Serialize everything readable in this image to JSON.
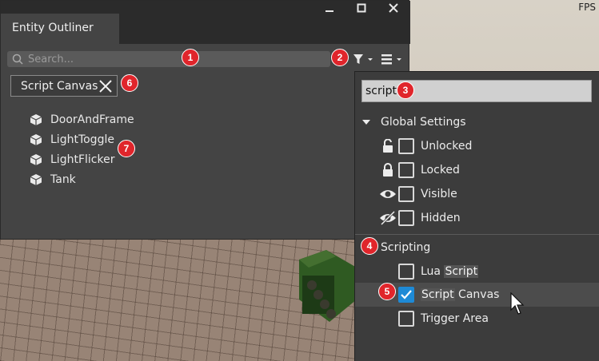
{
  "viewport": {
    "fps_label": "FPS"
  },
  "window": {
    "tab_title": "Entity Outliner"
  },
  "search": {
    "placeholder": "Search..."
  },
  "active_filter": {
    "label": "Script Canvas"
  },
  "entities": [
    {
      "name": "DoorAndFrame",
      "icon": "entity-cube-icon"
    },
    {
      "name": "LightToggle",
      "icon": "entity-cube-icon"
    },
    {
      "name": "LightFlicker",
      "icon": "entity-cube-icon"
    },
    {
      "name": "Tank",
      "icon": "entity-cube-icon"
    }
  ],
  "filter_menu": {
    "search_value": "script",
    "global_settings": {
      "label": "Global Settings",
      "options": [
        {
          "label": "Unlocked",
          "icon": "unlock-icon",
          "checked": false
        },
        {
          "label": "Locked",
          "icon": "lock-icon",
          "checked": false
        },
        {
          "label": "Visible",
          "icon": "eye-icon",
          "checked": false
        },
        {
          "label": "Hidden",
          "icon": "eye-slash-icon",
          "checked": false
        }
      ]
    },
    "scripting": {
      "label": "Scripting",
      "options": [
        {
          "pre": "Lua ",
          "match": "Script",
          "post": "",
          "checked": false
        },
        {
          "pre": "",
          "match": "Script",
          "post": " Canvas",
          "checked": true
        },
        {
          "pre": "Trigger Area",
          "match": "",
          "post": "",
          "checked": false
        }
      ]
    }
  },
  "badges": [
    "1",
    "2",
    "3",
    "4",
    "5",
    "6",
    "7"
  ],
  "colors": {
    "badge": "#e0252b",
    "checkbox_checked": "#1e8ad6",
    "panel_bg": "#444444"
  }
}
